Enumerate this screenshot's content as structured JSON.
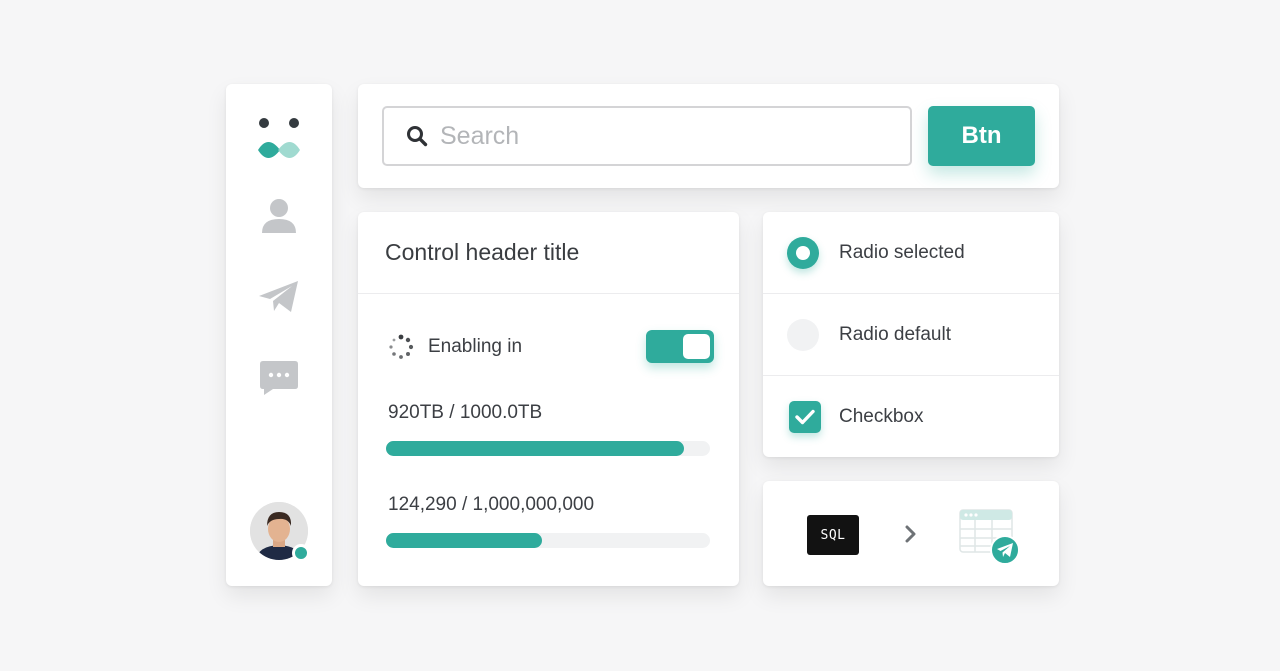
{
  "sidebar": {
    "items": [
      {
        "icon": "logo-icon"
      },
      {
        "icon": "user-icon"
      },
      {
        "icon": "paper-plane-icon"
      },
      {
        "icon": "chat-bubble-icon"
      }
    ],
    "avatar": {
      "status": "online"
    }
  },
  "search": {
    "placeholder": "Search",
    "value": "",
    "button_label": "Btn"
  },
  "control": {
    "header_title": "Control header title",
    "enabling_label": "Enabling in",
    "toggle_on": true,
    "usage": [
      {
        "label": "920TB / 1000.0TB",
        "fraction": 0.92
      },
      {
        "label": "124,290 / 1,000,000,000",
        "fraction": 0.48
      }
    ]
  },
  "options": {
    "radio_selected_label": "Radio selected",
    "radio_default_label": "Radio default",
    "checkbox_label": "Checkbox",
    "checkbox_checked": true
  },
  "pipeline": {
    "source_label": "SQL"
  },
  "colors": {
    "accent": "#2fab9c",
    "background": "#f6f6f7",
    "card": "#ffffff",
    "icon_gray": "#c4c6c9",
    "text": "#3c3f44"
  }
}
